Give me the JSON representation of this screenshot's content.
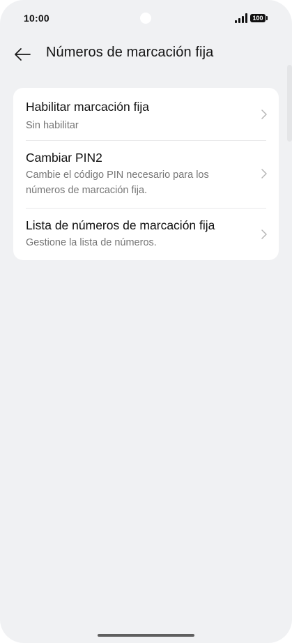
{
  "status_bar": {
    "time": "10:00",
    "battery_level": "100",
    "icons": [
      "signal-icon",
      "battery-icon"
    ]
  },
  "header": {
    "title": "Números de marcación fija",
    "back_icon": "back-arrow-icon"
  },
  "settings": {
    "items": [
      {
        "title": "Habilitar marcación fija",
        "subtitle": "Sin habilitar"
      },
      {
        "title": "Cambiar PIN2",
        "subtitle": "Cambie el código PIN necesario para los números de marcación fija."
      },
      {
        "title": "Lista de números de marcación fija",
        "subtitle": "Gestione la lista de números."
      }
    ],
    "item_icon": "chevron-right-icon"
  },
  "colors": {
    "background": "#f0f1f3",
    "card": "#ffffff",
    "title_text": "#111111",
    "secondary_text": "#757575"
  }
}
